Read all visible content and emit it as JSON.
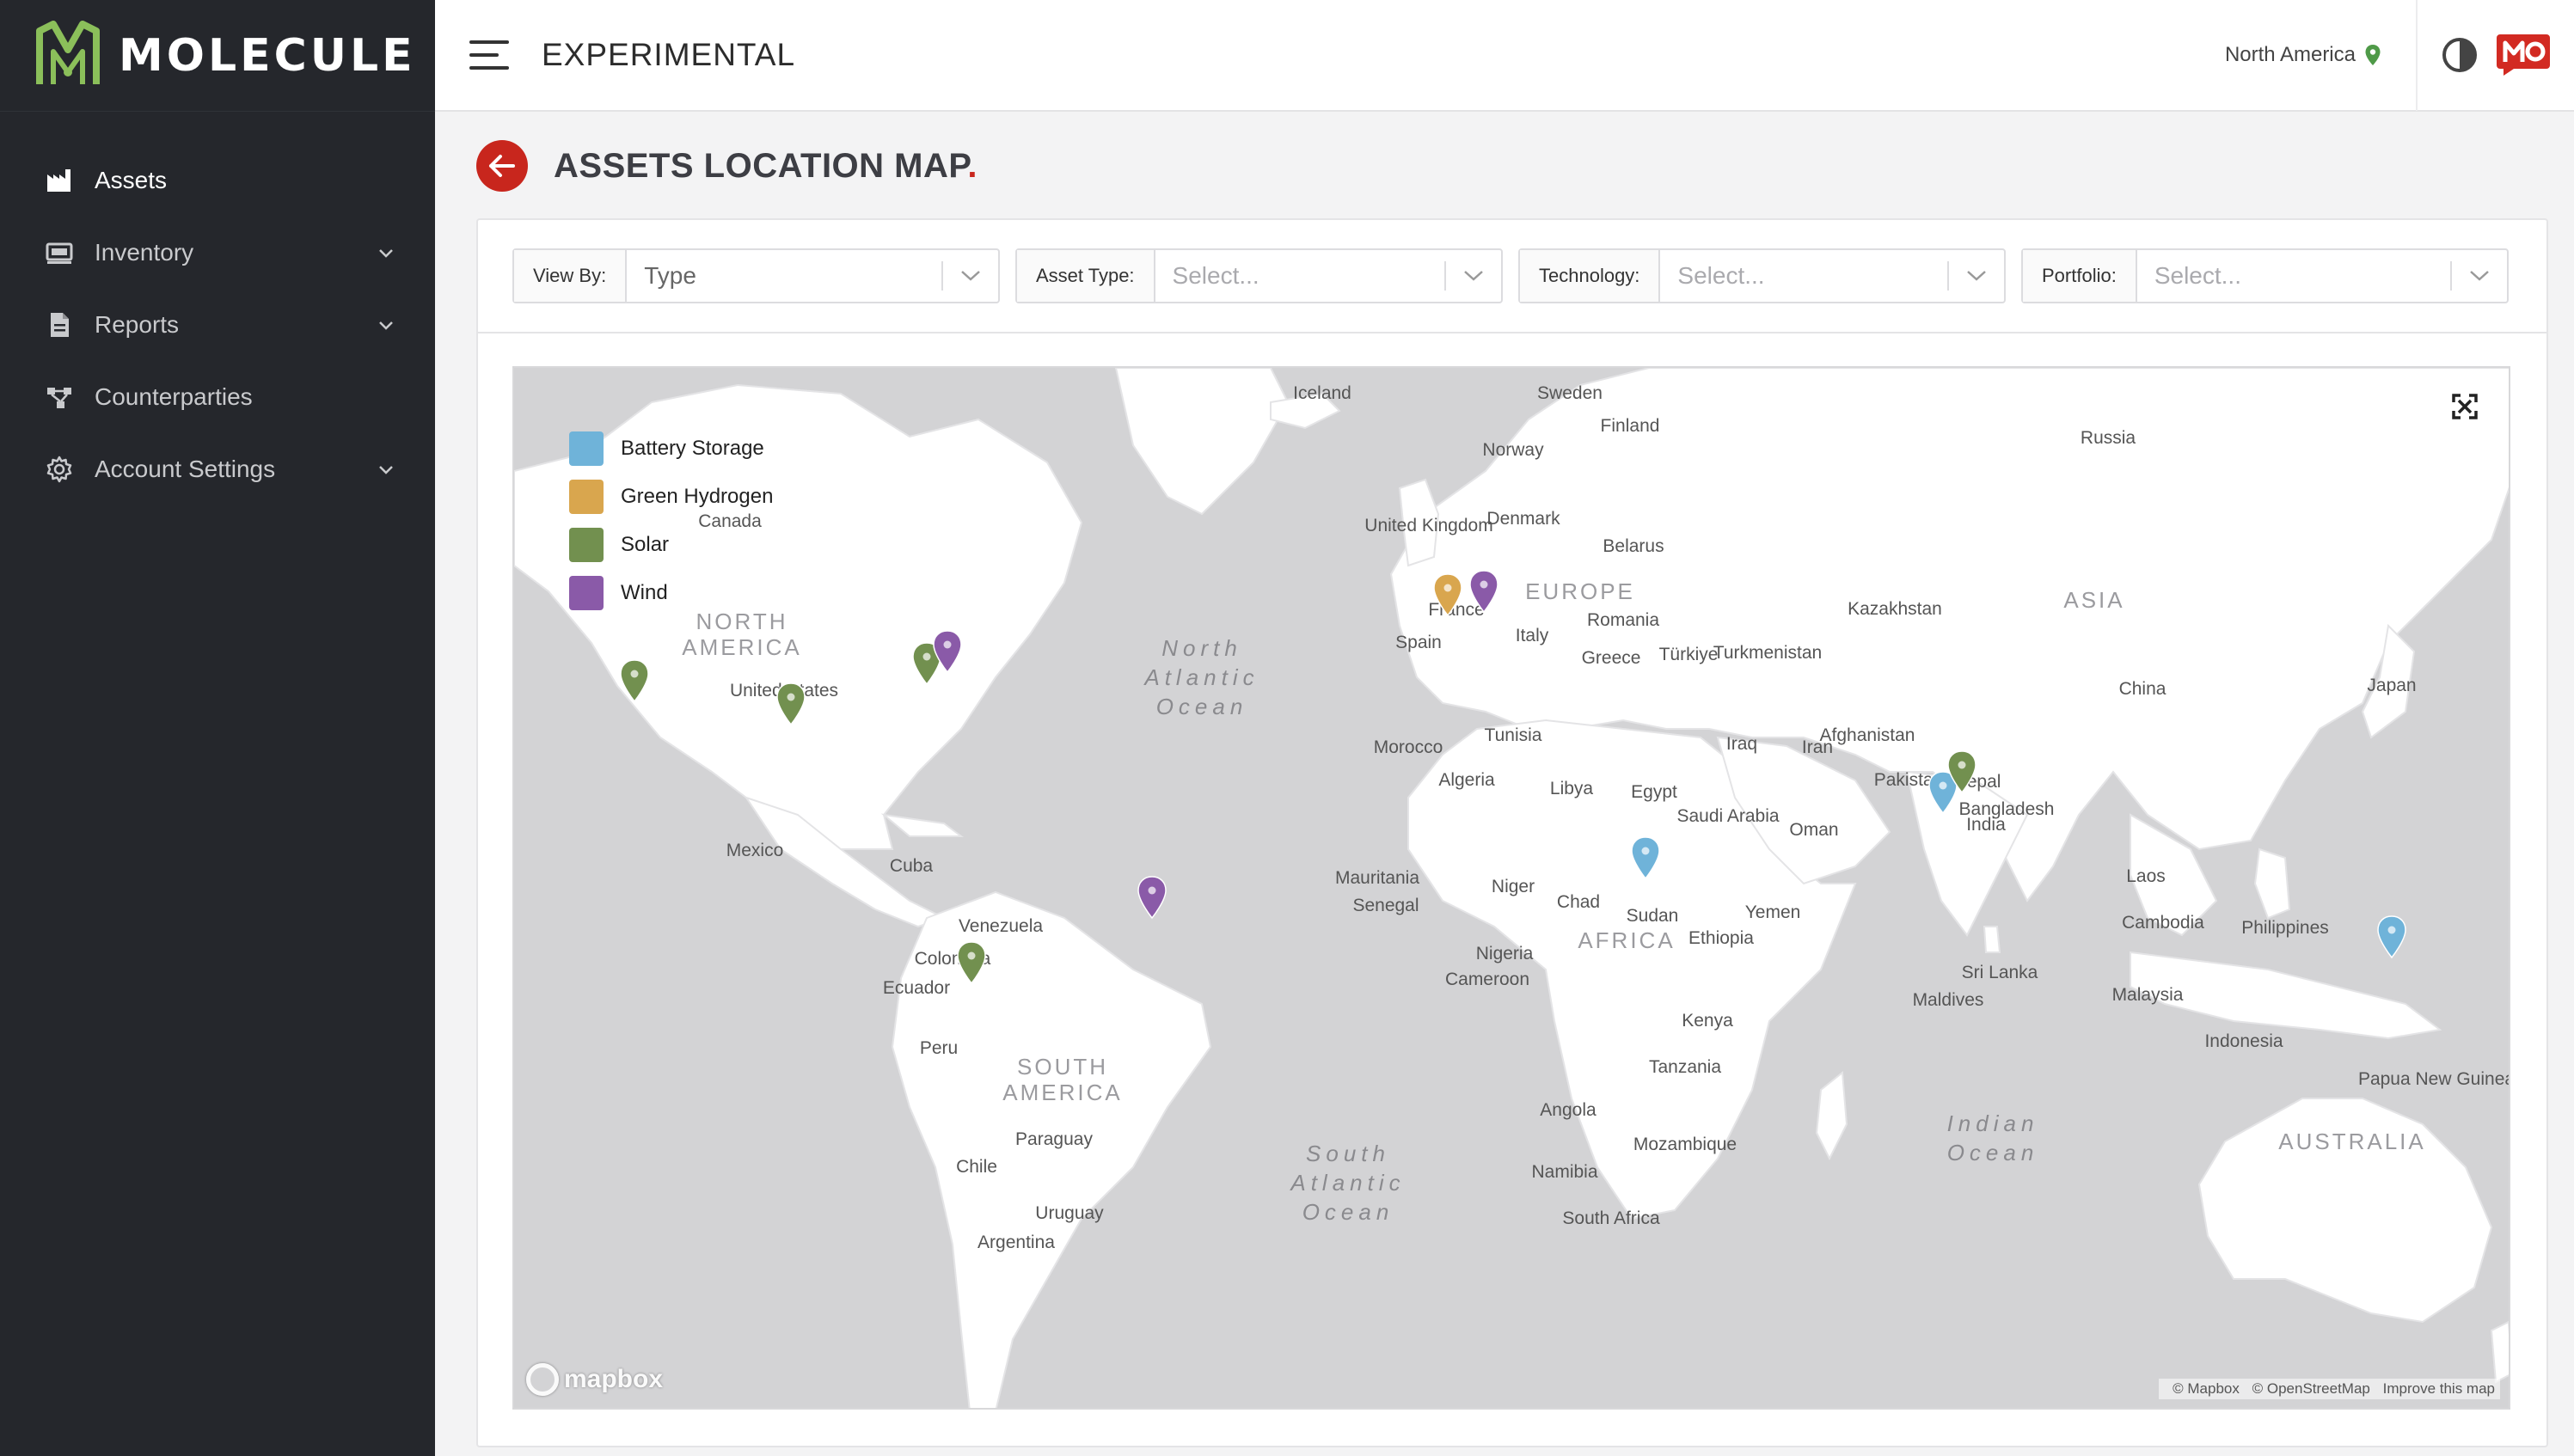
{
  "brand": {
    "name": "MOLECULE"
  },
  "sidebar": {
    "items": [
      {
        "label": "Assets",
        "icon": "factory-icon",
        "has_children": false,
        "active": true
      },
      {
        "label": "Inventory",
        "icon": "inventory-icon",
        "has_children": true,
        "active": false
      },
      {
        "label": "Reports",
        "icon": "document-icon",
        "has_children": true,
        "active": false
      },
      {
        "label": "Counterparties",
        "icon": "network-icon",
        "has_children": false,
        "active": false
      },
      {
        "label": "Account Settings",
        "icon": "gear-icon",
        "has_children": true,
        "active": false
      }
    ]
  },
  "header": {
    "title": "EXPERIMENTAL",
    "region": "North America"
  },
  "page": {
    "title": "ASSETS LOCATION MAP",
    "title_dot": "."
  },
  "filters": [
    {
      "label": "View By:",
      "value": "Type",
      "placeholder": false
    },
    {
      "label": "Asset Type:",
      "value": "Select...",
      "placeholder": true
    },
    {
      "label": "Technology:",
      "value": "Select...",
      "placeholder": true
    },
    {
      "label": "Portfolio:",
      "value": "Select...",
      "placeholder": true
    }
  ],
  "legend": [
    {
      "label": "Battery Storage",
      "color": "#6fb3d9"
    },
    {
      "label": "Green Hydrogen",
      "color": "#d9a64e"
    },
    {
      "label": "Solar",
      "color": "#72904f"
    },
    {
      "label": "Wind",
      "color": "#8a5aa8"
    }
  ],
  "map": {
    "labels": [
      "Iceland",
      "Sweden",
      "Finland",
      "Norway",
      "Russia",
      "Canada",
      "Denmark",
      "United Kingdom",
      "Belarus",
      "France",
      "Romania",
      "Kazakhstan",
      "Spain",
      "Italy",
      "Greece",
      "Türkiye",
      "Turkmenistan",
      "United States",
      "China",
      "Japan",
      "Tunisia",
      "Morocco",
      "Iraq",
      "Iran",
      "Afghanistan",
      "Algeria",
      "Libya",
      "Egypt",
      "Pakistan",
      "Nepal",
      "Mexico",
      "Saudi Arabia",
      "Oman",
      "Bangladesh",
      "India",
      "Cuba",
      "Mauritania",
      "Niger",
      "Chad",
      "Senegal",
      "Sudan",
      "Yemen",
      "Laos",
      "Cambodia",
      "Philippines",
      "Venezuela",
      "Nigeria",
      "Ethiopia",
      "Sri Lanka",
      "Colombia",
      "Cameroon",
      "Maldives",
      "Malaysia",
      "Ecuador",
      "Kenya",
      "Indonesia",
      "Tanzania",
      "Papua New Guinea",
      "Peru",
      "Angola",
      "Mozambique",
      "Paraguay",
      "Namibia",
      "Chile",
      "South Africa",
      "Uruguay",
      "Argentina"
    ],
    "continents": [
      "NORTH AMERICA",
      "EUROPE",
      "ASIA",
      "AFRICA",
      "SOUTH AMERICA",
      "AUSTRALIA"
    ],
    "oceans": [
      "North Atlantic Ocean",
      "South Atlantic Ocean",
      "Indian Ocean"
    ],
    "pins": [
      {
        "type": "Solar"
      },
      {
        "type": "Solar"
      },
      {
        "type": "Solar"
      },
      {
        "type": "Wind"
      },
      {
        "type": "Green Hydrogen"
      },
      {
        "type": "Wind"
      },
      {
        "type": "Battery Storage"
      },
      {
        "type": "Solar"
      },
      {
        "type": "Battery Storage"
      },
      {
        "type": "Wind"
      },
      {
        "type": "Solar"
      },
      {
        "type": "Battery Storage"
      }
    ],
    "logo": "mapbox",
    "attribution": [
      "© Mapbox",
      "© OpenStreetMap",
      "Improve this map"
    ]
  }
}
